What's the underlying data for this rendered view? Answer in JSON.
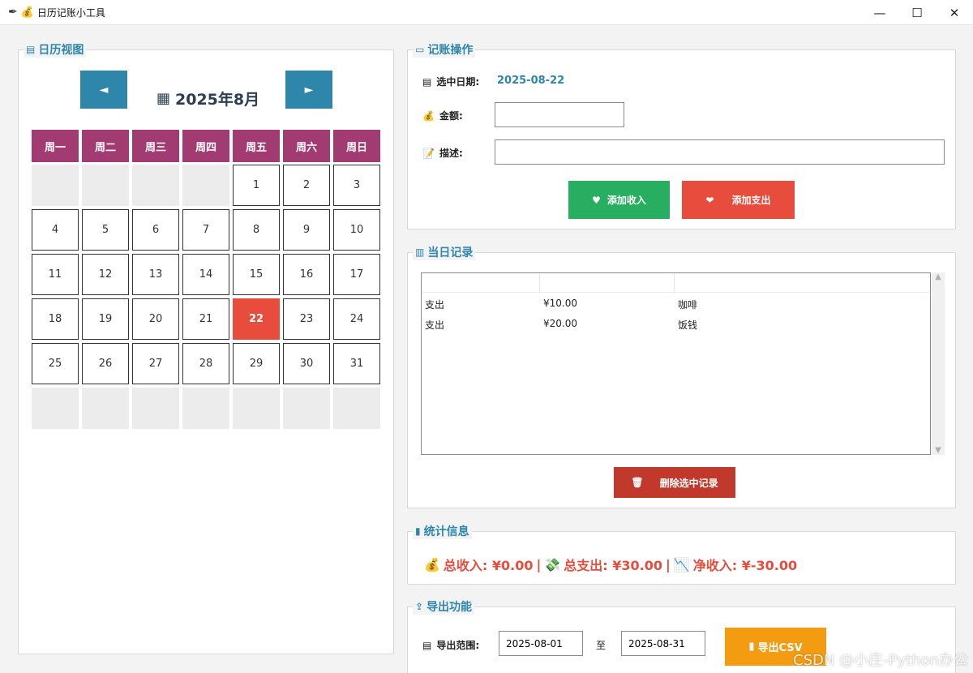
{
  "window": {
    "title": "日历记账小工具",
    "minimize": "—",
    "maximize": "☐",
    "close": "✕"
  },
  "calendar": {
    "section_title": "日历视图",
    "month_title": "2025年8月",
    "prev_label": "◄",
    "next_label": "►",
    "weekdays": [
      "周一",
      "周二",
      "周三",
      "周四",
      "周五",
      "周六",
      "周日"
    ],
    "selected_day": "22",
    "days": [
      "",
      "",
      "",
      "",
      "1",
      "2",
      "3",
      "4",
      "5",
      "6",
      "7",
      "8",
      "9",
      "10",
      "11",
      "12",
      "13",
      "14",
      "15",
      "16",
      "17",
      "18",
      "19",
      "20",
      "21",
      "22",
      "23",
      "24",
      "25",
      "26",
      "27",
      "28",
      "29",
      "30",
      "31",
      "",
      "",
      "",
      "",
      "",
      "",
      ""
    ]
  },
  "entry": {
    "section_title": "记账操作",
    "date_label": "选中日期:",
    "date_value": "2025-08-22",
    "amount_label": "金额:",
    "amount_value": "",
    "desc_label": "描述:",
    "desc_value": "",
    "add_income": "添加收入",
    "add_expense": "添加支出"
  },
  "records": {
    "section_title": "当日记录",
    "rows": [
      {
        "type": "支出",
        "amount": "¥10.00",
        "desc": "咖啡"
      },
      {
        "type": "支出",
        "amount": "¥20.00",
        "desc": "饭钱"
      }
    ],
    "delete_label": "删除选中记录"
  },
  "stats": {
    "section_title": "统计信息",
    "income_label": "总收入: ¥0.00",
    "sep": "|",
    "expense_label": "总支出: ¥30.00",
    "net_label": "净收入: ¥-30.00"
  },
  "export": {
    "section_title": "导出功能",
    "range_label": "导出范围:",
    "start_date": "2025-08-01",
    "to_label": "至",
    "end_date": "2025-08-31",
    "export_label": "导出CSV"
  },
  "watermark": "CSDN @小庄-Python办公",
  "colors": {
    "accent": "#2e86ab",
    "weekday": "#a23b72",
    "selected": "#e74c3c",
    "income_btn": "#27ae60",
    "expense_btn": "#e74c3c",
    "delete_btn": "#c0392b",
    "export_btn": "#f39c12"
  }
}
